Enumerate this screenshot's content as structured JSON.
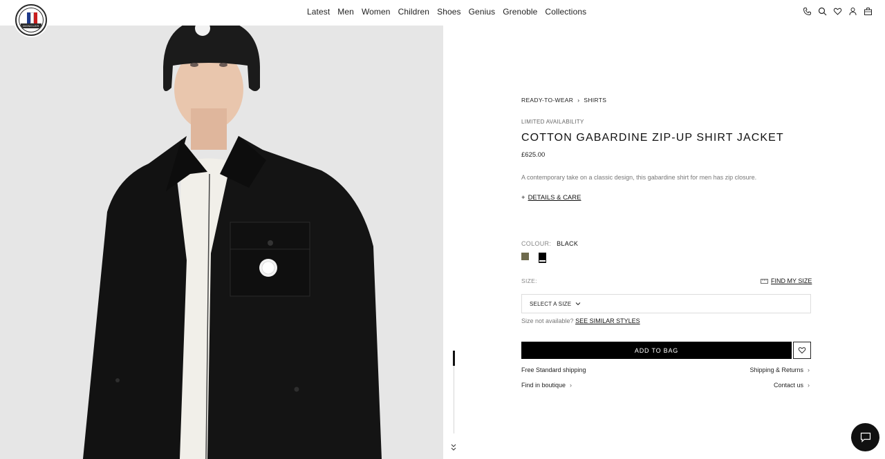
{
  "brand": {
    "logo_text": "MONCLER"
  },
  "nav": {
    "items": [
      "Latest",
      "Men",
      "Women",
      "Children",
      "Shoes",
      "Genius",
      "Grenoble",
      "Collections"
    ]
  },
  "header_icons": [
    "phone-icon",
    "search-icon",
    "heart-icon",
    "user-icon",
    "bag-icon"
  ],
  "product": {
    "breadcrumb": [
      "READY-TO-WEAR",
      "SHIRTS"
    ],
    "availability": "LIMITED AVAILABILITY",
    "title": "COTTON GABARDINE ZIP-UP SHIRT JACKET",
    "price": "£625.00",
    "description": "A contemporary take on a classic design, this gabardine shirt for men has zip closure.",
    "details_label": "DETAILS & CARE",
    "colour_label": "COLOUR:",
    "colour_value": "BLACK",
    "swatches": [
      {
        "name": "olive",
        "color": "#6e6a4d"
      },
      {
        "name": "black",
        "color": "#000000",
        "selected": true
      }
    ],
    "size_label": "SIZE:",
    "find_size_label": "FIND MY SIZE",
    "size_select_placeholder": "SELECT A SIZE",
    "not_available_text": "Size not available?",
    "similar_styles_label": "SEE SIMILAR STYLES",
    "add_to_bag_label": "ADD TO BAG",
    "free_shipping": "Free Standard shipping",
    "shipping_returns": "Shipping & Returns",
    "find_boutique": "Find in boutique",
    "contact_us": "Contact us"
  },
  "colors": {
    "accent": "#000000",
    "muted": "#777777",
    "hero_bg": "#e8e8e8"
  }
}
